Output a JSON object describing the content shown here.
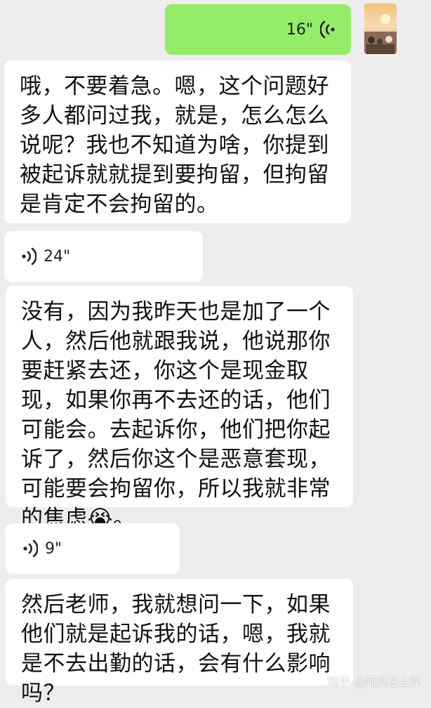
{
  "messages": [
    {
      "type": "voice",
      "side": "out",
      "duration": "16\""
    },
    {
      "type": "text",
      "side": "in",
      "text": "哦，不要着急。嗯，这个问题好多人都问过我，就是，怎么怎么说呢？我也不知道为啥，你提到被起诉就就提到要拘留，但拘留是肯定不会拘留的。"
    },
    {
      "type": "voice",
      "side": "in",
      "duration": "24\""
    },
    {
      "type": "text",
      "side": "in",
      "text": "没有，因为我昨天也是加了一个人，然后他就跟我说，他说那你要赶紧去还，你这个是现金取现，如果你再不去还的话，他们可能会。去起诉你，他们把你起诉了，然后你这个是恶意套现，可能要会拘留你，所以我就非常的焦虑😭。"
    },
    {
      "type": "voice",
      "side": "in",
      "duration": "9\""
    },
    {
      "type": "text",
      "side": "in",
      "text": "然后老师，我就想问一下，如果他们就是起诉我的话，嗯，我就是不去出勤的话，会有什么影响吗？"
    }
  ],
  "watermark": "知乎 @阿凡在上岸",
  "colors": {
    "bg": "#ededed",
    "outgoing": "#95ec69",
    "incoming": "#ffffff"
  },
  "icons": {
    "voice": "voice-wave-icon",
    "avatar": "user-avatar"
  }
}
